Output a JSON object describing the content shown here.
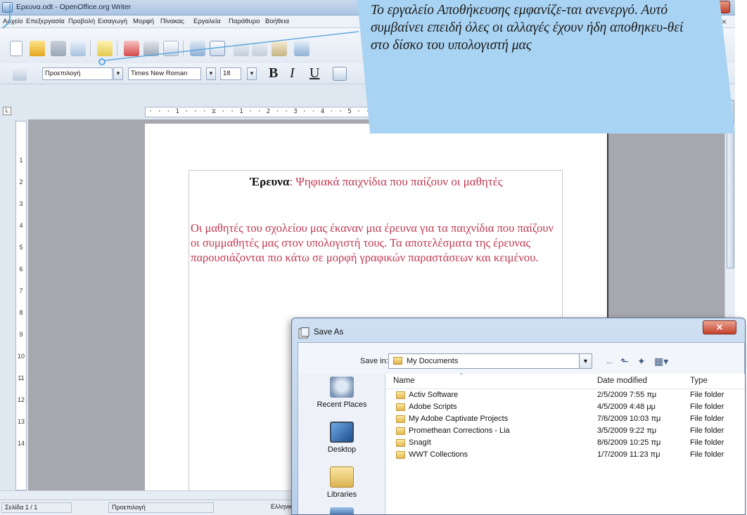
{
  "writer": {
    "title": "Ερευνα.odt - OpenOffice.org Writer",
    "doc_close_glyph": "×",
    "menu": [
      "Αρχείο",
      "Επεξεργασία",
      "Προβολή",
      "Εισαγωγή",
      "Μορφή",
      "Πίνακας",
      "Εργαλεία",
      "Παράθυρο",
      "Βοήθεια"
    ],
    "style_combo": "Προεπιλογή",
    "font_combo": "Times New Roman",
    "size_combo": "18",
    "bold": "B",
    "italic": "I",
    "underline": "U",
    "ruler_h": "· · · 1 · · · ⧖ · · 1 · · 2 · · 3 · · 4 · · 5 · · 6 · · 7 ·",
    "ruler_v": [
      "1",
      "2",
      "3",
      "4",
      "5",
      "6",
      "7",
      "8",
      "9",
      "10",
      "11",
      "12",
      "13",
      "14"
    ],
    "document": {
      "heading_bold": "Έρευνα",
      "heading_rest": ": Ψηφιακά παιχνίδια που παίζουν οι μαθητές",
      "body": "Οι μαθητές του σχολείου μας έκαναν μια έρευνα για τα παιχνίδια που παίζουν οι συμμαθητές μας στον υπολογιστή τους. Τα αποτελέσματα της έρευνας παρουσιάζονται πιο κάτω σε μορφή γραφικών παραστάσεων και κειμένου."
    },
    "status": {
      "page": "Σελίδα 1 / 1",
      "style": "Προεπιλογή",
      "language": "Ελληνικ"
    }
  },
  "callout": {
    "text": "Το εργαλείο Αποθήκευσης εμφανίζε-ται ανενεργό. Αυτό συμβαίνει επειδή όλες οι αλλαγές έχουν ήδη αποθηκευ-θεί στο δίσκο του υπολογιστή μας",
    "color": "#a9d3f2"
  },
  "save_dialog": {
    "title": "Save As",
    "save_in_label": "Save in:",
    "save_in_value": "My Documents",
    "places": [
      "Recent Places",
      "Desktop",
      "Libraries"
    ],
    "columns": [
      "Name",
      "Date modified",
      "Type"
    ],
    "rows": [
      {
        "name": "Activ Software",
        "date": "2/5/2009 7:55 πμ",
        "type": "File folder"
      },
      {
        "name": "Adobe Scripts",
        "date": "4/5/2009 4:48 μμ",
        "type": "File folder"
      },
      {
        "name": "My Adobe Captivate Projects",
        "date": "7/6/2009 10:03 πμ",
        "type": "File folder"
      },
      {
        "name": "Promethean Corrections - Lia",
        "date": "3/5/2009 9:22 πμ",
        "type": "File folder"
      },
      {
        "name": "SnagIt",
        "date": "8/6/2009 10:25 πμ",
        "type": "File folder"
      },
      {
        "name": "WWT Collections",
        "date": "1/7/2009 11:23 πμ",
        "type": "File folder"
      }
    ]
  }
}
